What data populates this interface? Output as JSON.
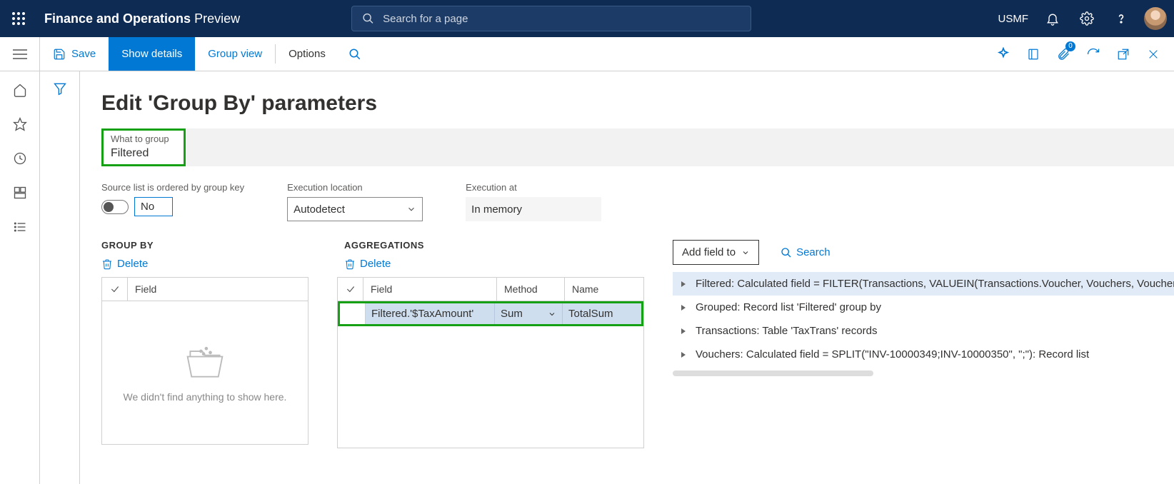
{
  "header": {
    "app_title": "Finance and Operations",
    "app_title_suffix": "Preview",
    "search_placeholder": "Search for a page",
    "company": "USMF"
  },
  "actionbar": {
    "save": "Save",
    "show_details": "Show details",
    "group_view": "Group view",
    "options": "Options",
    "attachment_count": "0"
  },
  "page": {
    "title": "Edit 'Group By' parameters"
  },
  "what_to_group": {
    "label": "What to group",
    "value": "Filtered"
  },
  "params": {
    "ordered_label": "Source list is ordered by group key",
    "ordered_value": "No",
    "exec_location_label": "Execution location",
    "exec_location_value": "Autodetect",
    "exec_at_label": "Execution at",
    "exec_at_value": "In memory"
  },
  "group_by": {
    "heading": "GROUP BY",
    "delete": "Delete",
    "field_header": "Field",
    "empty_message": "We didn't find anything to show here."
  },
  "aggregations": {
    "heading": "AGGREGATIONS",
    "delete": "Delete",
    "field_header": "Field",
    "method_header": "Method",
    "name_header": "Name",
    "row": {
      "field": "Filtered.'$TaxAmount'",
      "method": "Sum",
      "name": "TotalSum"
    }
  },
  "right": {
    "add_field": "Add field to",
    "search": "Search",
    "tree": [
      "Filtered: Calculated field = FILTER(Transactions, VALUEIN(Transactions.Voucher, Vouchers, Vouchers.Value))",
      "Grouped: Record list 'Filtered' group by",
      "Transactions: Table 'TaxTrans' records",
      "Vouchers: Calculated field = SPLIT(\"INV-10000349;INV-10000350\", \";\"): Record list"
    ]
  }
}
